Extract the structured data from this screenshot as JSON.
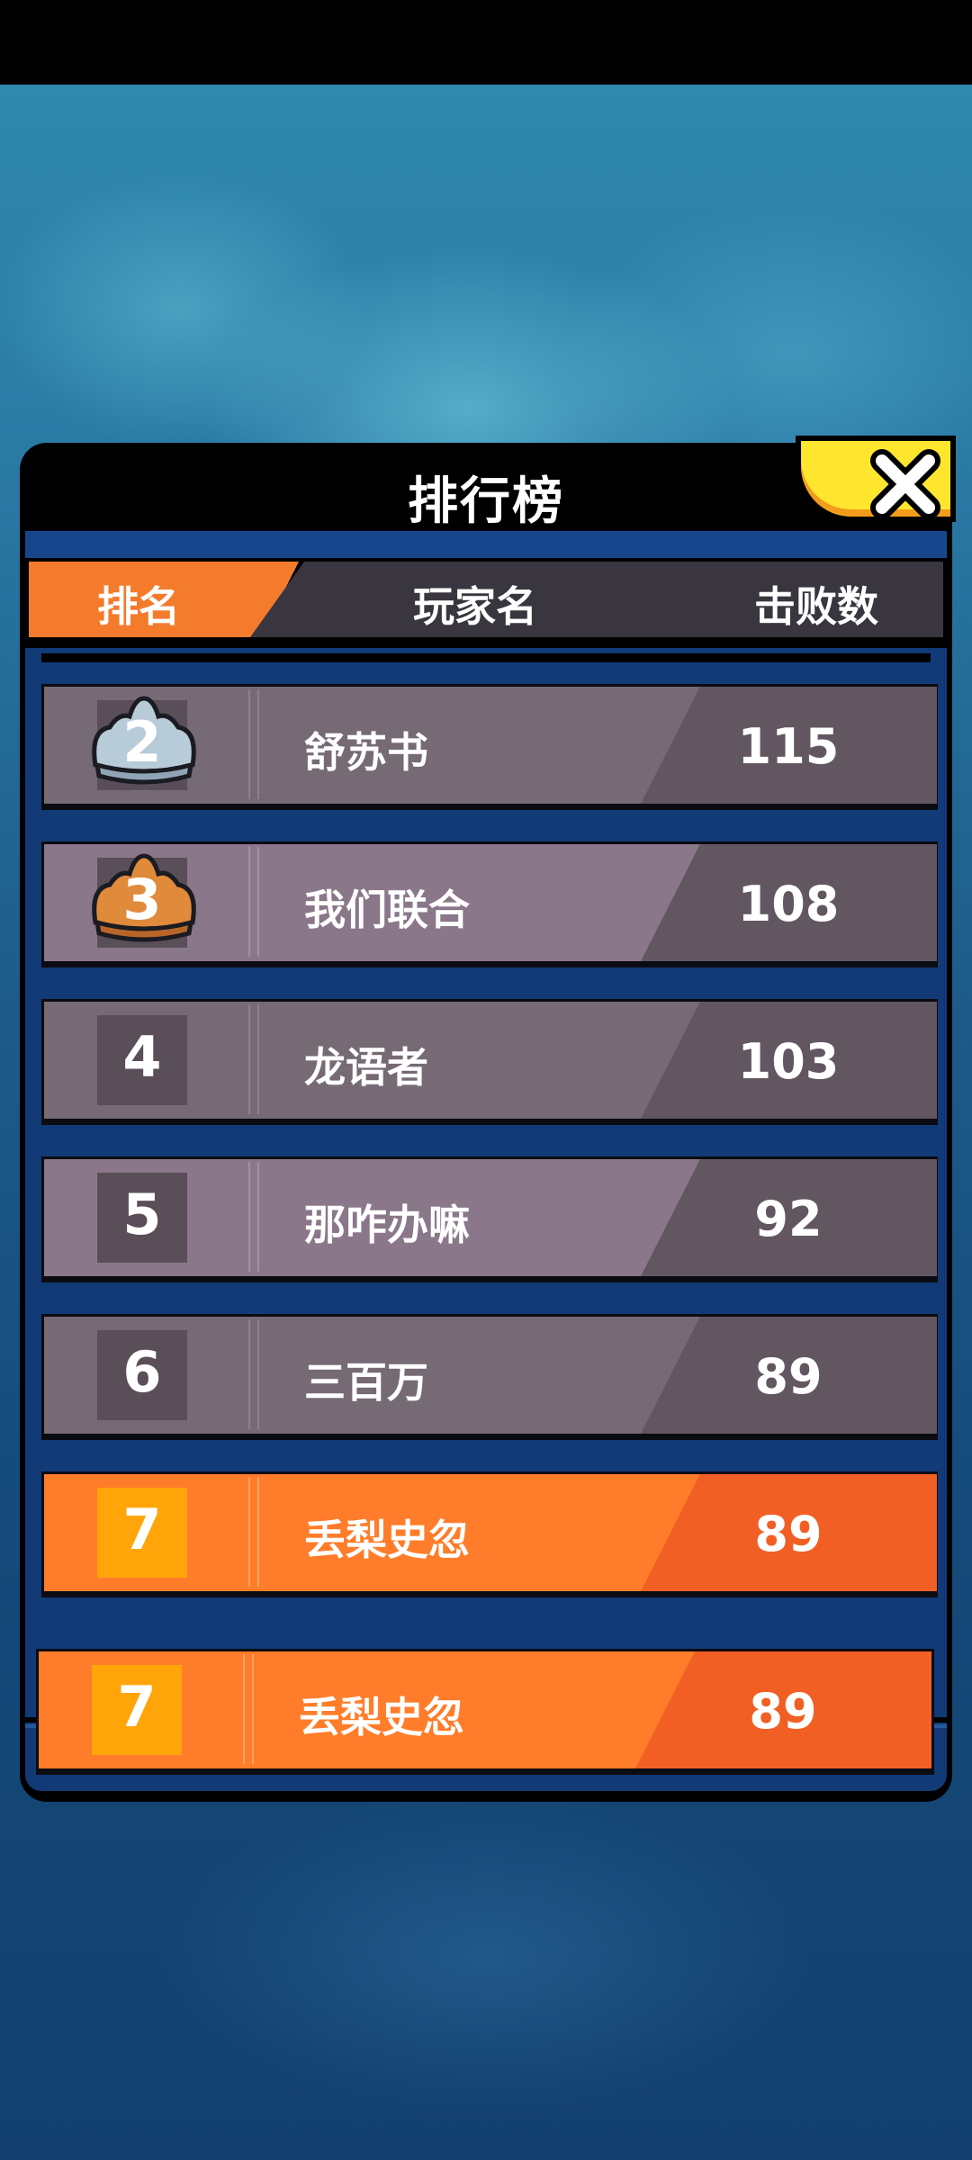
{
  "leaderboard": {
    "title": "排行榜",
    "columns": {
      "rank": "排名",
      "player": "玩家名",
      "kills": "击败数"
    },
    "rows": [
      {
        "rank": "2",
        "name": "舒苏书",
        "kills": "115",
        "badge": "silver-crown"
      },
      {
        "rank": "3",
        "name": "我们联合",
        "kills": "108",
        "badge": "bronze-crown"
      },
      {
        "rank": "4",
        "name": "龙语者",
        "kills": "103"
      },
      {
        "rank": "5",
        "name": "那咋办嘛",
        "kills": "92"
      },
      {
        "rank": "6",
        "name": "三百万",
        "kills": "89"
      },
      {
        "rank": "7",
        "name": "丢梨史忽",
        "kills": "89",
        "highlight": true
      }
    ],
    "my_row": {
      "rank": "7",
      "name": "丢梨史忽",
      "kills": "89"
    }
  },
  "icons": {
    "close": "close-icon"
  },
  "colors": {
    "accent_orange": "#ff7d2a",
    "close_button": "#ffe62e",
    "panel_blue": "#123a77"
  }
}
